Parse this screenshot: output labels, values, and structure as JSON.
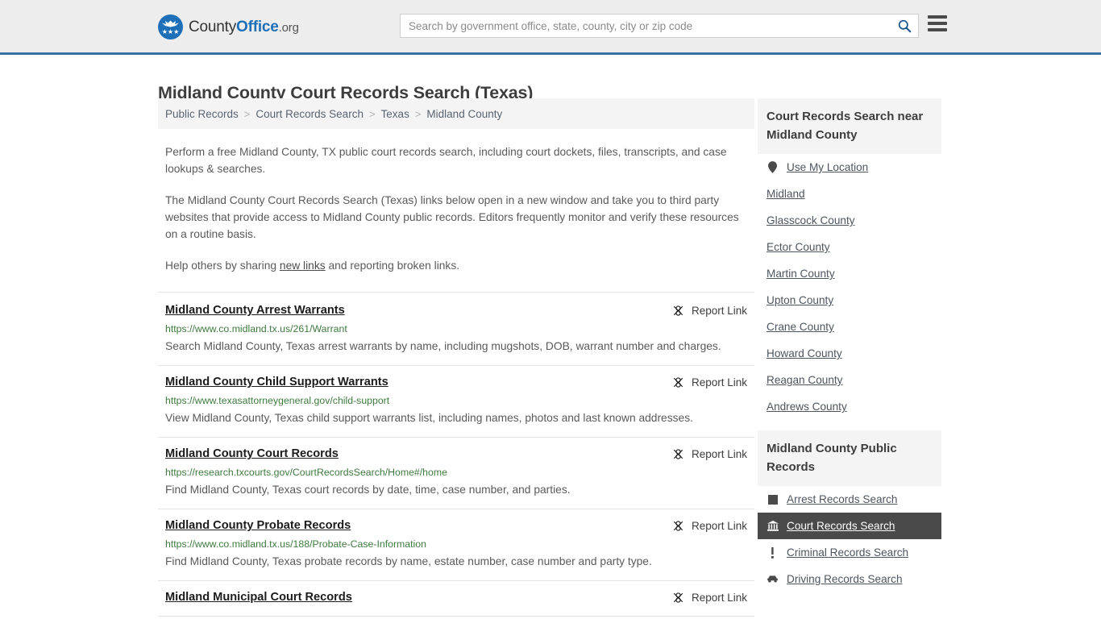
{
  "header": {
    "logo": {
      "county": "County",
      "office": "Office",
      "org": ".org",
      "icon": "eagle-seal-icon"
    },
    "search": {
      "placeholder": "Search by government office, state, county, city or zip code",
      "value": "",
      "icon": "search-icon"
    },
    "menu_icon": "hamburger-menu-icon",
    "accent_color": "#3a72a4",
    "background_color": "#ededed"
  },
  "page": {
    "title": "Midland County Court Records Search (Texas)"
  },
  "breadcrumb": {
    "items": [
      {
        "label": "Public Records",
        "current": false
      },
      {
        "label": "Court Records Search",
        "current": false
      },
      {
        "label": "Texas",
        "current": false
      },
      {
        "label": "Midland County",
        "current": true
      }
    ],
    "separator": ">"
  },
  "intro": {
    "paragraph_1": "Perform a free Midland County, TX public court records search, including court dockets, files, transcripts, and case lookups & searches.",
    "paragraph_2": "The Midland County Court Records Search (Texas) links below open in a new window and take you to third party websites that provide access to Midland County public records. Editors frequently monitor and verify these resources on a routine basis.",
    "paragraph_3_pre": "Help others by sharing ",
    "paragraph_3_link": "new links",
    "paragraph_3_post": " and reporting broken links."
  },
  "results": {
    "report_link_label": "Report Link",
    "report_link_icon": "broken-link-icon",
    "items": [
      {
        "title": "Midland County Arrest Warrants",
        "url": "https://www.co.midland.tx.us/261/Warrant",
        "description": "Search Midland County, Texas arrest warrants by name, including mugshots, DOB, warrant number and charges."
      },
      {
        "title": "Midland County Child Support Warrants",
        "url": "https://www.texasattorneygeneral.gov/child-support",
        "description": "View Midland County, Texas child support warrants list, including names, photos and last known addresses."
      },
      {
        "title": "Midland County Court Records",
        "url": "https://research.txcourts.gov/CourtRecordsSearch/Home#/home",
        "description": "Find Midland County, Texas court records by date, time, case number, and parties."
      },
      {
        "title": "Midland County Probate Records",
        "url": "https://www.co.midland.tx.us/188/Probate-Case-Information",
        "description": "Find Midland County, Texas probate records by name, estate number, case number and party type."
      },
      {
        "title": "Midland Municipal Court Records",
        "url": "",
        "description": ""
      }
    ]
  },
  "sidebar": {
    "nearby": {
      "heading": "Court Records Search near Midland County",
      "items": [
        {
          "label": "Use My Location",
          "icon": "map-pin-icon"
        },
        {
          "label": "Midland",
          "icon": ""
        },
        {
          "label": "Glasscock County",
          "icon": ""
        },
        {
          "label": "Ector County",
          "icon": ""
        },
        {
          "label": "Martin County",
          "icon": ""
        },
        {
          "label": "Upton County",
          "icon": ""
        },
        {
          "label": "Crane County",
          "icon": ""
        },
        {
          "label": "Howard County",
          "icon": ""
        },
        {
          "label": "Reagan County",
          "icon": ""
        },
        {
          "label": "Andrews County",
          "icon": ""
        }
      ]
    },
    "public_records": {
      "heading": "Midland County Public Records",
      "items": [
        {
          "label": "Arrest Records Search",
          "icon": "document-square-icon",
          "active": false
        },
        {
          "label": "Court Records Search",
          "icon": "courthouse-icon",
          "active": true
        },
        {
          "label": "Criminal Records Search",
          "icon": "exclamation-icon",
          "active": false
        },
        {
          "label": "Driving Records Search",
          "icon": "car-icon",
          "active": false
        }
      ],
      "active_background": "#4a4a4a"
    }
  }
}
